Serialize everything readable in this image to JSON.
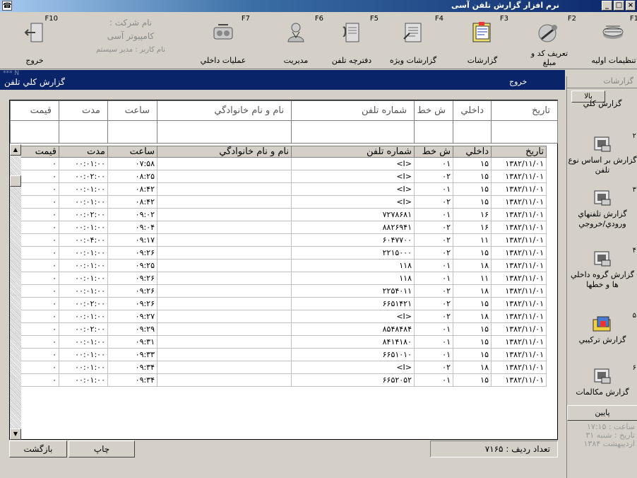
{
  "window": {
    "title": "نرم افزار گزارش تلفن آسی",
    "close": "×",
    "maximize": "□",
    "minimize": "_"
  },
  "toolbar": [
    {
      "key": "F1",
      "label": "تنظيمات اوليه",
      "icon": "settings-icon"
    },
    {
      "key": "F2",
      "label": "تعريف کد و مبلغ",
      "icon": "define-code-icon"
    },
    {
      "key": "F3",
      "label": "گزارشات",
      "icon": "reports-icon"
    },
    {
      "key": "F4",
      "label": "گزارشات ويژه",
      "icon": "special-reports-icon"
    },
    {
      "key": "F5",
      "label": "دفترچه تلفن",
      "icon": "phonebook-icon"
    },
    {
      "key": "F6",
      "label": "مديريت",
      "icon": "management-icon"
    },
    {
      "key": "F7",
      "label": "عمليات داخلي",
      "icon": "internal-ops-icon"
    },
    {
      "key": "F10",
      "label": "خروج",
      "icon": "exit-icon"
    }
  ],
  "company": {
    "line1": "نام شرکت :",
    "line2": "کامپيوتر آسی",
    "user": "نام کاربر : مدير سيستم"
  },
  "report": {
    "title": "گزارش کلي تلفن",
    "exit": "خروج",
    "stars": "*** N"
  },
  "columns": [
    "تاريخ",
    "داخلي",
    "ش خط",
    "شماره تلفن",
    "نام و نام خانوادگي",
    "ساعت",
    "مدت",
    "قيمت"
  ],
  "rows": [
    [
      "۱۳۸۲/۱۱/۰۱",
      "۱۵",
      "۰۱",
      "<I>",
      "",
      "۰۷:۵۸",
      "۰۰:۰۱:۰۰",
      "۰"
    ],
    [
      "۱۳۸۲/۱۱/۰۱",
      "۱۵",
      "۰۲",
      "<I>",
      "",
      "۰۸:۲۵",
      "۰۰:۰۲:۰۰",
      "۰"
    ],
    [
      "۱۳۸۲/۱۱/۰۱",
      "۱۵",
      "۰۱",
      "<I>",
      "",
      "۰۸:۴۲",
      "۰۰:۰۱:۰۰",
      "۰"
    ],
    [
      "۱۳۸۲/۱۱/۰۱",
      "۱۵",
      "۰۲",
      "<I>",
      "",
      "۰۸:۴۲",
      "۰۰:۰۱:۰۰",
      "۰"
    ],
    [
      "۱۳۸۲/۱۱/۰۱",
      "۱۶",
      "۰۱",
      "۷۲۷۸۶۸۱",
      "",
      "۰۹:۰۲",
      "۰۰:۰۲:۰۰",
      "۰"
    ],
    [
      "۱۳۸۲/۱۱/۰۱",
      "۱۶",
      "۰۲",
      "۸۸۲۶۹۴۱",
      "",
      "۰۹:۰۴",
      "۰۰:۰۱:۰۰",
      "۰"
    ],
    [
      "۱۳۸۲/۱۱/۰۱",
      "۱۱",
      "۰۲",
      "۶۰۴۷۷۰۰",
      "",
      "۰۹:۱۷",
      "۰۰:۰۴:۰۰",
      "۰"
    ],
    [
      "۱۳۸۲/۱۱/۰۱",
      "۱۵",
      "۰۲",
      "۲۲۱۵۰۰۰",
      "",
      "۰۹:۲۶",
      "۰۰:۰۱:۰۰",
      "۰"
    ],
    [
      "۱۳۸۲/۱۱/۰۱",
      "۱۸",
      "۰۱",
      "۱۱۸",
      "",
      "۰۹:۲۵",
      "۰۰:۰۱:۰۰",
      "۰"
    ],
    [
      "۱۳۸۲/۱۱/۰۱",
      "۱۱",
      "۰۱",
      "۱۱۸",
      "",
      "۰۹:۲۶",
      "۰۰:۰۱:۰۰",
      "۰"
    ],
    [
      "۱۳۸۲/۱۱/۰۱",
      "۱۸",
      "۰۲",
      "۲۲۵۴۰۱۱",
      "",
      "۰۹:۲۶",
      "۰۰:۰۱:۰۰",
      "۰"
    ],
    [
      "۱۳۸۲/۱۱/۰۱",
      "۱۵",
      "۰۲",
      "۶۶۵۱۴۲۱",
      "",
      "۰۹:۲۶",
      "۰۰:۰۲:۰۰",
      "۰"
    ],
    [
      "۱۳۸۲/۱۱/۰۱",
      "۱۸",
      "۰۲",
      "<I>",
      "",
      "۰۹:۲۷",
      "۰۰:۰۱:۰۰",
      "۰"
    ],
    [
      "۱۳۸۲/۱۱/۰۱",
      "۱۵",
      "۰۱",
      "۸۵۴۸۴۸۴",
      "",
      "۰۹:۲۹",
      "۰۰:۰۲:۰۰",
      "۰"
    ],
    [
      "۱۳۸۲/۱۱/۰۱",
      "۱۵",
      "۰۱",
      "۸۴۱۴۱۸۰",
      "",
      "۰۹:۳۱",
      "۰۰:۰۱:۰۰",
      "۰"
    ],
    [
      "۱۳۸۲/۱۱/۰۱",
      "۱۵",
      "۰۱",
      "۶۶۵۱۰۱۰",
      "",
      "۰۹:۳۳",
      "۰۰:۰۱:۰۰",
      "۰"
    ],
    [
      "۱۳۸۲/۱۱/۰۱",
      "۱۸",
      "۰۲",
      "<I>",
      "",
      "۰۹:۳۴",
      "۰۰:۰۱:۰۰",
      "۰"
    ],
    [
      "۱۳۸۲/۱۱/۰۱",
      "۱۵",
      "۰۱",
      "۶۶۵۲۰۵۲",
      "",
      "۰۹:۳۴",
      "۰۰:۰۱:۰۰",
      "۰"
    ]
  ],
  "footer": {
    "row_count": "تعداد رديف :  ۷۱۶۵",
    "print": "چاپ",
    "back": "بازگشت"
  },
  "sidebar": {
    "header": "گزارشات",
    "up": "بالا",
    "down": "پايين",
    "items": [
      {
        "num": "",
        "label": "گزارش کلي"
      },
      {
        "num": "۲",
        "label": "گزارش بر اساس نوع تلفن"
      },
      {
        "num": "۳",
        "label": "گزارش تلفنهاي ورودي/خروجي"
      },
      {
        "num": "۴",
        "label": "گزارش گروه داخلي ها و خطها"
      },
      {
        "num": "۵",
        "label": "گزارش ترکيبي"
      },
      {
        "num": "۶",
        "label": "گزارش مکالمات"
      }
    ],
    "time": "ساعت :  ۱۷:۱۵",
    "date": "تاريخ :  شنبه  ۳۱ ارديبهشت  ۱۳۸۴"
  }
}
